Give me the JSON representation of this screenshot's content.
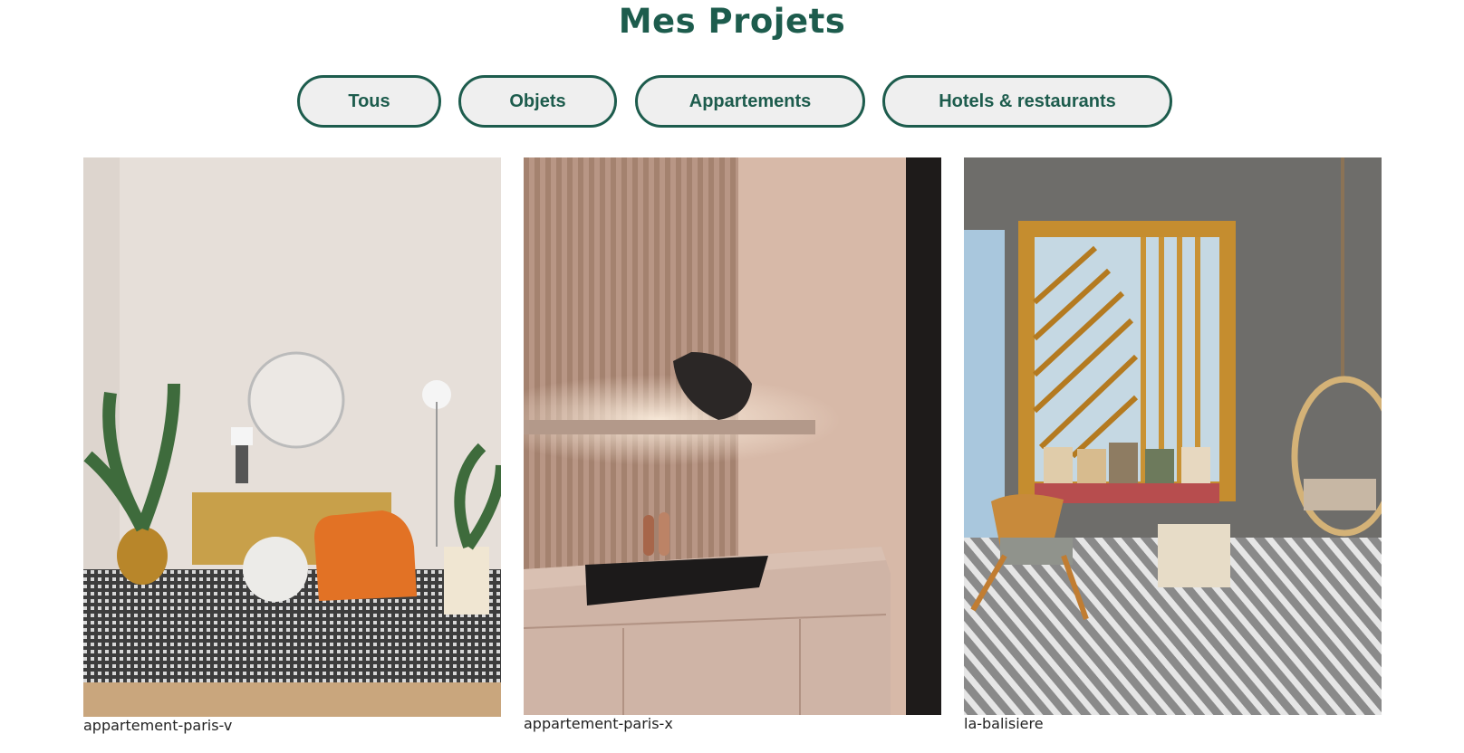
{
  "page": {
    "title": "Mes Projets"
  },
  "filters": [
    {
      "label": "Tous"
    },
    {
      "label": "Objets"
    },
    {
      "label": "Appartements"
    },
    {
      "label": "Hotels & restaurants"
    }
  ],
  "projects": [
    {
      "caption": "appartement-paris-v",
      "image": "living-room-photo"
    },
    {
      "caption": "appartement-paris-x",
      "image": "kitchen-photo"
    },
    {
      "caption": "la-balisiere",
      "image": "hotel-lounge-photo"
    }
  ],
  "colors": {
    "accent": "#1d5c4d",
    "button_bg": "#efefef"
  }
}
